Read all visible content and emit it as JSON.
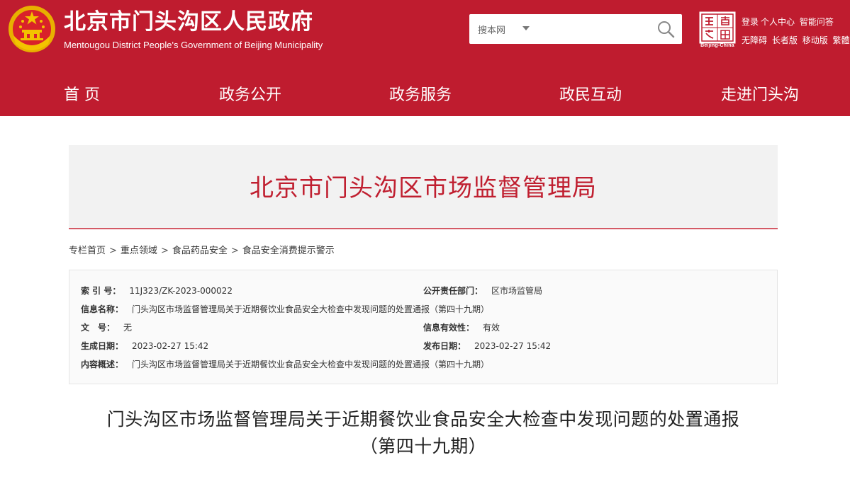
{
  "header": {
    "title": "北京市门头沟区人民政府",
    "subtitle": "Mentougou District People's Government of Beijing Municipality",
    "search": {
      "scope": "搜本网",
      "placeholder": ""
    },
    "logo_tag": "Beijing-China",
    "links_row1": [
      "登录",
      "个人中心",
      "智能问答"
    ],
    "links_row2": [
      "无障碍",
      "长者版",
      "移动版",
      "繁體"
    ],
    "colors": {
      "brand_red": "#bf1c2f",
      "white": "#ffffff"
    }
  },
  "nav": {
    "items": [
      "首 页",
      "政务公开",
      "政务服务",
      "政民互动",
      "走进门头沟"
    ]
  },
  "banner": {
    "title": "北京市门头沟区市场监督管理局"
  },
  "breadcrumb": [
    "专栏首页",
    "重点领域",
    "食品药品安全",
    "食品安全消费提示警示"
  ],
  "info": {
    "index_label": "索 引 号：",
    "index_value": "11J323/ZK-2023-000022",
    "dept_label": "公开责任部门：",
    "dept_value": "区市场监管局",
    "name_label": "信息名称：",
    "name_value": "门头沟区市场监督管理局关于近期餐饮业食品安全大检查中发现问题的处置通报（第四十九期）",
    "docno_label": "文　号：",
    "docno_value": "无",
    "valid_label": "信息有效性：",
    "valid_value": "有效",
    "created_label": "生成日期：",
    "created_value": "2023-02-27 15:42",
    "published_label": "发布日期：",
    "published_value": "2023-02-27 15:42",
    "summary_label": "内容概述：",
    "summary_value": "门头沟区市场监督管理局关于近期餐饮业食品安全大检查中发现问题的处置通报（第四十九期）"
  },
  "article": {
    "title_line1": "门头沟区市场监督管理局关于近期餐饮业食品安全大检查中发现问题的处置通报",
    "title_line2": "（第四十九期）"
  }
}
